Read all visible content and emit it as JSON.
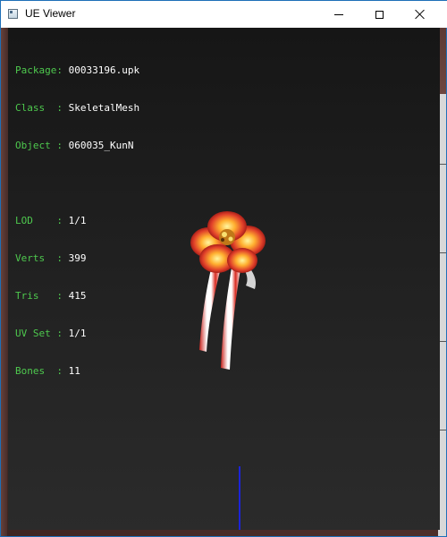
{
  "window": {
    "title": "UE Viewer"
  },
  "info": {
    "package_label": "Package:",
    "package_value": "00033196.upk",
    "class_label": "Class  :",
    "class_value": "SkeletalMesh",
    "object_label": "Object :",
    "object_value": "060035_KunN",
    "lod_label": "LOD    :",
    "lod_value": "1/1",
    "verts_label": "Verts  :",
    "verts_value": "399",
    "tris_label": "Tris   :",
    "tris_value": "415",
    "uvset_label": "UV Set :",
    "uvset_value": "1/1",
    "bones_label": "Bones  :",
    "bones_value": "11"
  },
  "colors": {
    "label": "#4ec94e",
    "value": "#ffffff",
    "axis": "#1c24d8",
    "viewport_top": "#161616",
    "viewport_bottom": "#2b2b2b"
  },
  "icons": {
    "app": "app-icon",
    "minimize": "minimize-icon",
    "maximize": "maximize-icon",
    "close": "close-icon"
  }
}
